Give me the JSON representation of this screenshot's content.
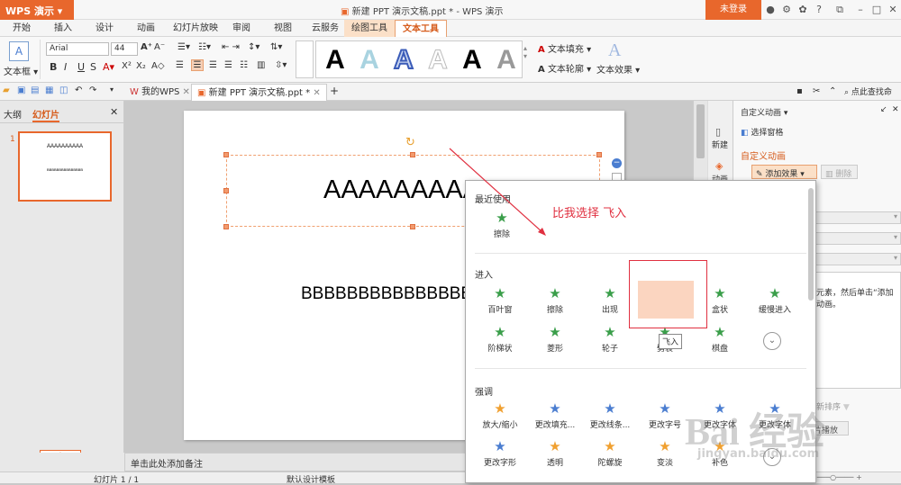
{
  "app": {
    "logo": "WPS 演示",
    "window_title": "新建 PPT 演示文稿.ppt * - WPS 演示",
    "login": "未登录"
  },
  "menu": [
    "开始",
    "插入",
    "设计",
    "动画",
    "幻灯片放映",
    "审阅",
    "视图",
    "云服务",
    "绘图工具",
    "文本工具"
  ],
  "ribbon": {
    "textbox": "文本框",
    "font": "Arial",
    "size": "44",
    "fill": "文本填充",
    "outline": "文本轮廓",
    "effect": "文本效果",
    "style_glyph": "A"
  },
  "tabs": {
    "mywps": "我的WPS",
    "doc": "新建 PPT 演示文稿.ppt *",
    "help": "点此查找命"
  },
  "left": {
    "outline": "大纲",
    "slides": "幻灯片",
    "num": "1",
    "thumb_title": "AAAAAAAAAA",
    "thumb_body": "BBBBBBBBBBBBBBB"
  },
  "slide": {
    "title": "AAAAAAAAAA",
    "body": "BBBBBBBBBBBBBBB"
  },
  "notes": "单击此处添加备注",
  "status": {
    "page": "幻灯片 1 / 1",
    "template": "默认设计模板"
  },
  "rstrip": {
    "new": "新建",
    "anim": "动画"
  },
  "rpanel": {
    "title": "自定义动画",
    "pane": "选择窗格",
    "section": "自定义动画",
    "add": "添加效果",
    "delete": "删除",
    "hint": "元素，然后单击“添加动画。",
    "reorder": "新排序",
    "play": "片播放"
  },
  "popup": {
    "recent_title": "最近使用",
    "recent": [
      {
        "label": "擦除",
        "color": "#3a9e4a"
      }
    ],
    "enter_title": "进入",
    "enter": [
      {
        "label": "百叶窗",
        "color": "#3a9e4a"
      },
      {
        "label": "擦除",
        "color": "#3a9e4a"
      },
      {
        "label": "出现",
        "color": "#3a9e4a"
      },
      {
        "label": "飞入",
        "color": "#3a9e4a"
      },
      {
        "label": "盒状",
        "color": "#3a9e4a"
      },
      {
        "label": "缓慢进入",
        "color": "#3a9e4a"
      },
      {
        "label": "阶梯状",
        "color": "#3a9e4a"
      },
      {
        "label": "菱形",
        "color": "#3a9e4a"
      },
      {
        "label": "轮子",
        "color": "#3a9e4a"
      },
      {
        "label": "劈裂",
        "color": "#3a9e4a"
      },
      {
        "label": "棋盘",
        "color": "#3a9e4a"
      }
    ],
    "tooltip": "飞入",
    "emph_title": "强调",
    "emph": [
      {
        "label": "放大/缩小",
        "color": "#f0a030"
      },
      {
        "label": "更改填充...",
        "color": "#4a7dd0"
      },
      {
        "label": "更改线条...",
        "color": "#4a7dd0"
      },
      {
        "label": "更改字号",
        "color": "#4a7dd0"
      },
      {
        "label": "更改字体",
        "color": "#4a7dd0"
      },
      {
        "label": "更改字体",
        "color": "#4a7dd0"
      },
      {
        "label": "更改字形",
        "color": "#4a7dd0"
      },
      {
        "label": "透明",
        "color": "#f0a030"
      },
      {
        "label": "陀螺旋",
        "color": "#f0a030"
      },
      {
        "label": "变淡",
        "color": "#f0a030"
      },
      {
        "label": "补色",
        "color": "#f0a030"
      }
    ]
  },
  "annotation": "比我选择 飞入",
  "watermark": {
    "logo": "Bai 经验",
    "url": "jingyan.baidu.com"
  }
}
